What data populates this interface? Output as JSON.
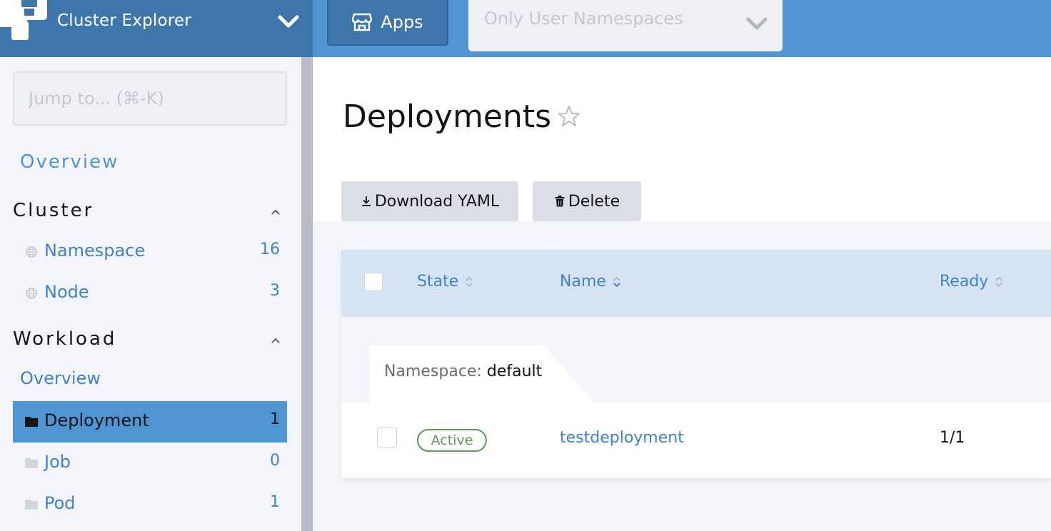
{
  "header": {
    "app_title": "Cluster Explorer",
    "apps_label": "Apps",
    "namespace_filter": "Only User Namespaces"
  },
  "sidebar": {
    "jump_placeholder": "Jump to... (⌘-K)",
    "overview_label": "Overview",
    "groups": [
      {
        "title": "Cluster",
        "items": [
          {
            "label": "Namespace",
            "count": "16",
            "icon": "globe-icon"
          },
          {
            "label": "Node",
            "count": "3",
            "icon": "globe-icon"
          }
        ]
      },
      {
        "title": "Workload",
        "overview_label": "Overview",
        "items": [
          {
            "label": "Deployment",
            "count": "1",
            "icon": "folder-icon",
            "active": true
          },
          {
            "label": "Job",
            "count": "0",
            "icon": "folder-icon"
          },
          {
            "label": "Pod",
            "count": "1",
            "icon": "folder-icon"
          }
        ]
      }
    ]
  },
  "main": {
    "title": "Deployments",
    "actions": {
      "download_label": "Download YAML",
      "delete_label": "Delete"
    },
    "table": {
      "columns": [
        "State",
        "Name",
        "Ready"
      ],
      "group": {
        "prefix": "Namespace:",
        "value": "default"
      },
      "rows": [
        {
          "state": "Active",
          "name": "testdeployment",
          "ready": "1/1"
        }
      ]
    }
  },
  "colors": {
    "header_bg": "#4f95d1",
    "brand_bg": "#3e76ac",
    "link": "#3e84c6",
    "active_bg": "#4f95d1",
    "status_active": "#5d995d",
    "table_header_bg": "#d6e3f2"
  }
}
